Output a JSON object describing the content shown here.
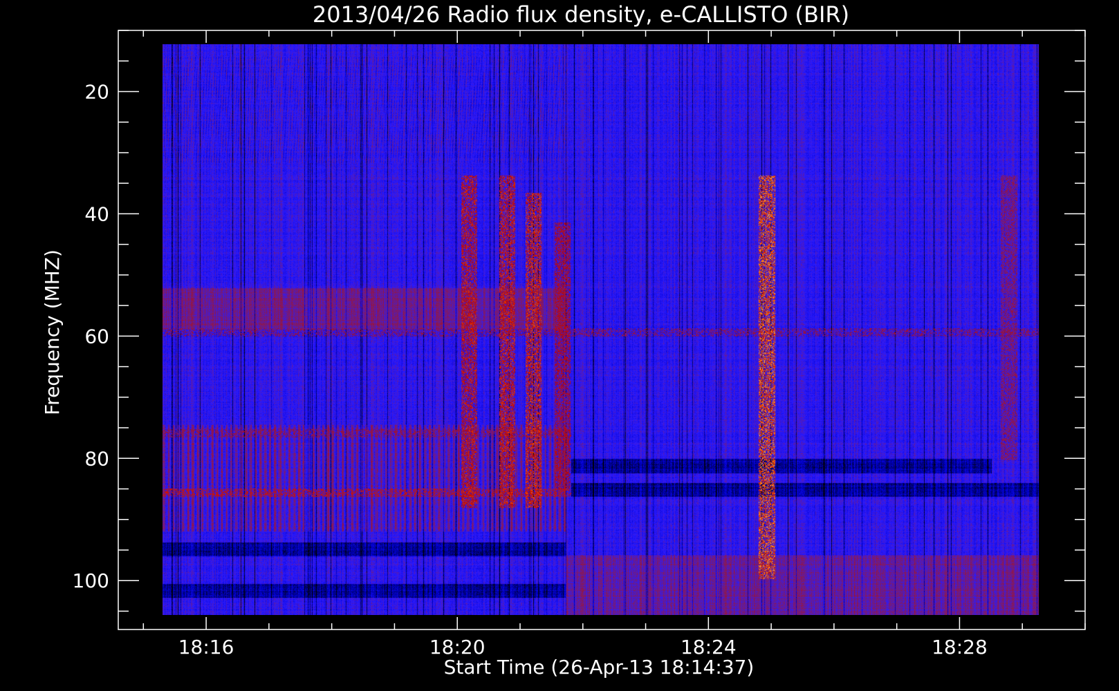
{
  "chart_data": {
    "type": "heatmap",
    "title": "2013/04/26  Radio flux density, e-CALLISTO (BIR)",
    "xlabel": "Start Time (26-Apr-13 18:14:37)",
    "ylabel": "Frequency (MHZ)",
    "x_ticks": [
      {
        "label": "18:16",
        "minutes": 16
      },
      {
        "label": "18:20",
        "minutes": 20
      },
      {
        "label": "18:24",
        "minutes": 24
      },
      {
        "label": "18:28",
        "minutes": 28
      }
    ],
    "x_minor_step_minutes": 1,
    "x_range_minutes": [
      14.6,
      30.0
    ],
    "data_time_range_minutes": [
      15.0,
      30.0
    ],
    "y_ticks": [
      20,
      40,
      60,
      80,
      100
    ],
    "y_minor_step": 5,
    "ylim": [
      10,
      108
    ],
    "data_frequency_range": [
      10,
      106
    ],
    "y_reversed": true,
    "grid": false,
    "colormap": [
      "#000000",
      "#0000cc",
      "#2a1aff",
      "#8a1a55",
      "#c00000",
      "#ff6000",
      "#ffff80"
    ],
    "background_level": 0.33,
    "regime_change_minutes": 21.9,
    "bright_bursts": [
      {
        "time_minutes": 20.25,
        "freq_min": 32,
        "freq_max": 88,
        "intensity": 0.8
      },
      {
        "time_minutes": 20.9,
        "freq_min": 32,
        "freq_max": 88,
        "intensity": 0.82
      },
      {
        "time_minutes": 21.35,
        "freq_min": 35,
        "freq_max": 88,
        "intensity": 0.85
      },
      {
        "time_minutes": 21.85,
        "freq_min": 40,
        "freq_max": 85,
        "intensity": 0.72
      },
      {
        "time_minutes": 25.35,
        "freq_min": 32,
        "freq_max": 100,
        "intensity": 0.95
      },
      {
        "time_minutes": 29.5,
        "freq_min": 32,
        "freq_max": 80,
        "intensity": 0.6
      }
    ],
    "interference_bands": [
      {
        "freq": 58.5,
        "time_min": 15,
        "time_max": 30,
        "intensity": 0.55
      },
      {
        "freq": 85.5,
        "time_min": 15,
        "time_max": 22,
        "intensity": 0.7
      },
      {
        "freq": 75.5,
        "time_min": 15,
        "time_max": 22,
        "intensity": 0.55
      }
    ],
    "dark_bands": [
      {
        "freq": 102,
        "time_min": 15,
        "time_max": 21.9
      },
      {
        "freq": 95,
        "time_min": 15,
        "time_max": 21.9
      },
      {
        "freq": 81,
        "time_min": 22,
        "time_max": 29.2
      },
      {
        "freq": 85,
        "time_min": 22,
        "time_max": 30
      }
    ]
  }
}
